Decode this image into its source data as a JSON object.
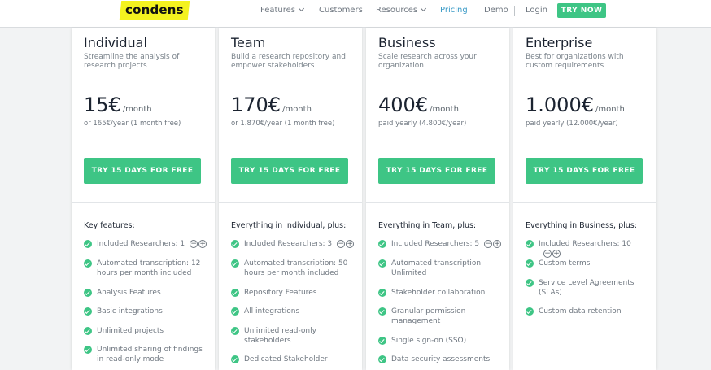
{
  "nav": {
    "logo": "condens",
    "items": [
      {
        "label": "Features",
        "dropdown": true
      },
      {
        "label": "Customers",
        "dropdown": false
      },
      {
        "label": "Resources",
        "dropdown": true
      },
      {
        "label": "Pricing",
        "dropdown": false,
        "active": true
      },
      {
        "label": "Demo",
        "dropdown": false
      },
      {
        "label": "Login",
        "dropdown": false
      }
    ],
    "cta": "TRY NOW"
  },
  "colors": {
    "accent": "#3ec585",
    "link_active": "#3b9bc7",
    "logo_bg": "#f4f21f"
  },
  "plans": [
    {
      "name": "Individual",
      "tagline": "Streamline the analysis of research projects",
      "price": "15€",
      "period": "/month",
      "billing": "or 165€/year (1 month free)",
      "cta": "TRY 15 DAYS FOR FREE",
      "features_heading": "Key features:",
      "features": [
        {
          "text": "Included Researchers: 1",
          "stepper": true
        },
        {
          "text": "Automated transcription: 12 hours per month included"
        },
        {
          "text": "Analysis Features"
        },
        {
          "text": "Basic integrations"
        },
        {
          "text": "Unlimited projects"
        },
        {
          "text": "Unlimited sharing of findings in read-only mode"
        }
      ]
    },
    {
      "name": "Team",
      "tagline": "Build a research repository and empower stakeholders",
      "price": "170€",
      "period": "/month",
      "billing": "or 1.870€/year (1 month free)",
      "cta": "TRY 15 DAYS FOR FREE",
      "features_heading": "Everything in Individual, plus:",
      "features": [
        {
          "text": "Included Researchers: 3",
          "stepper": true
        },
        {
          "text": "Automated transcription: 50 hours per month included"
        },
        {
          "text": "Repository Features"
        },
        {
          "text": "All integrations"
        },
        {
          "text": "Unlimited read-only stakeholders"
        },
        {
          "text": "Dedicated Stakeholder"
        }
      ]
    },
    {
      "name": "Business",
      "tagline": "Scale research across your organization",
      "price": "400€",
      "period": "/month",
      "billing": "paid yearly (4.800€/year)",
      "cta": "TRY 15 DAYS FOR FREE",
      "features_heading": "Everything in Team, plus:",
      "features": [
        {
          "text": "Included Researchers: 5",
          "stepper": true
        },
        {
          "text": "Automated transcription: Unlimited"
        },
        {
          "text": "Stakeholder collaboration"
        },
        {
          "text": "Granular permission management"
        },
        {
          "text": "Single sign-on (SSO)"
        },
        {
          "text": "Data security assessments"
        }
      ]
    },
    {
      "name": "Enterprise",
      "tagline": "Best for organizations with custom requirements",
      "price": "1.000€",
      "period": "/month",
      "billing": "paid yearly (12.000€/year)",
      "cta": "TRY 15 DAYS FOR FREE",
      "features_heading": "Everything in Business, plus:",
      "features": [
        {
          "text": "Included Researchers: 10",
          "stepper": true
        },
        {
          "text": "Custom terms"
        },
        {
          "text": "Service Level Agreements (SLAs)"
        },
        {
          "text": "Custom data retention"
        }
      ]
    }
  ]
}
